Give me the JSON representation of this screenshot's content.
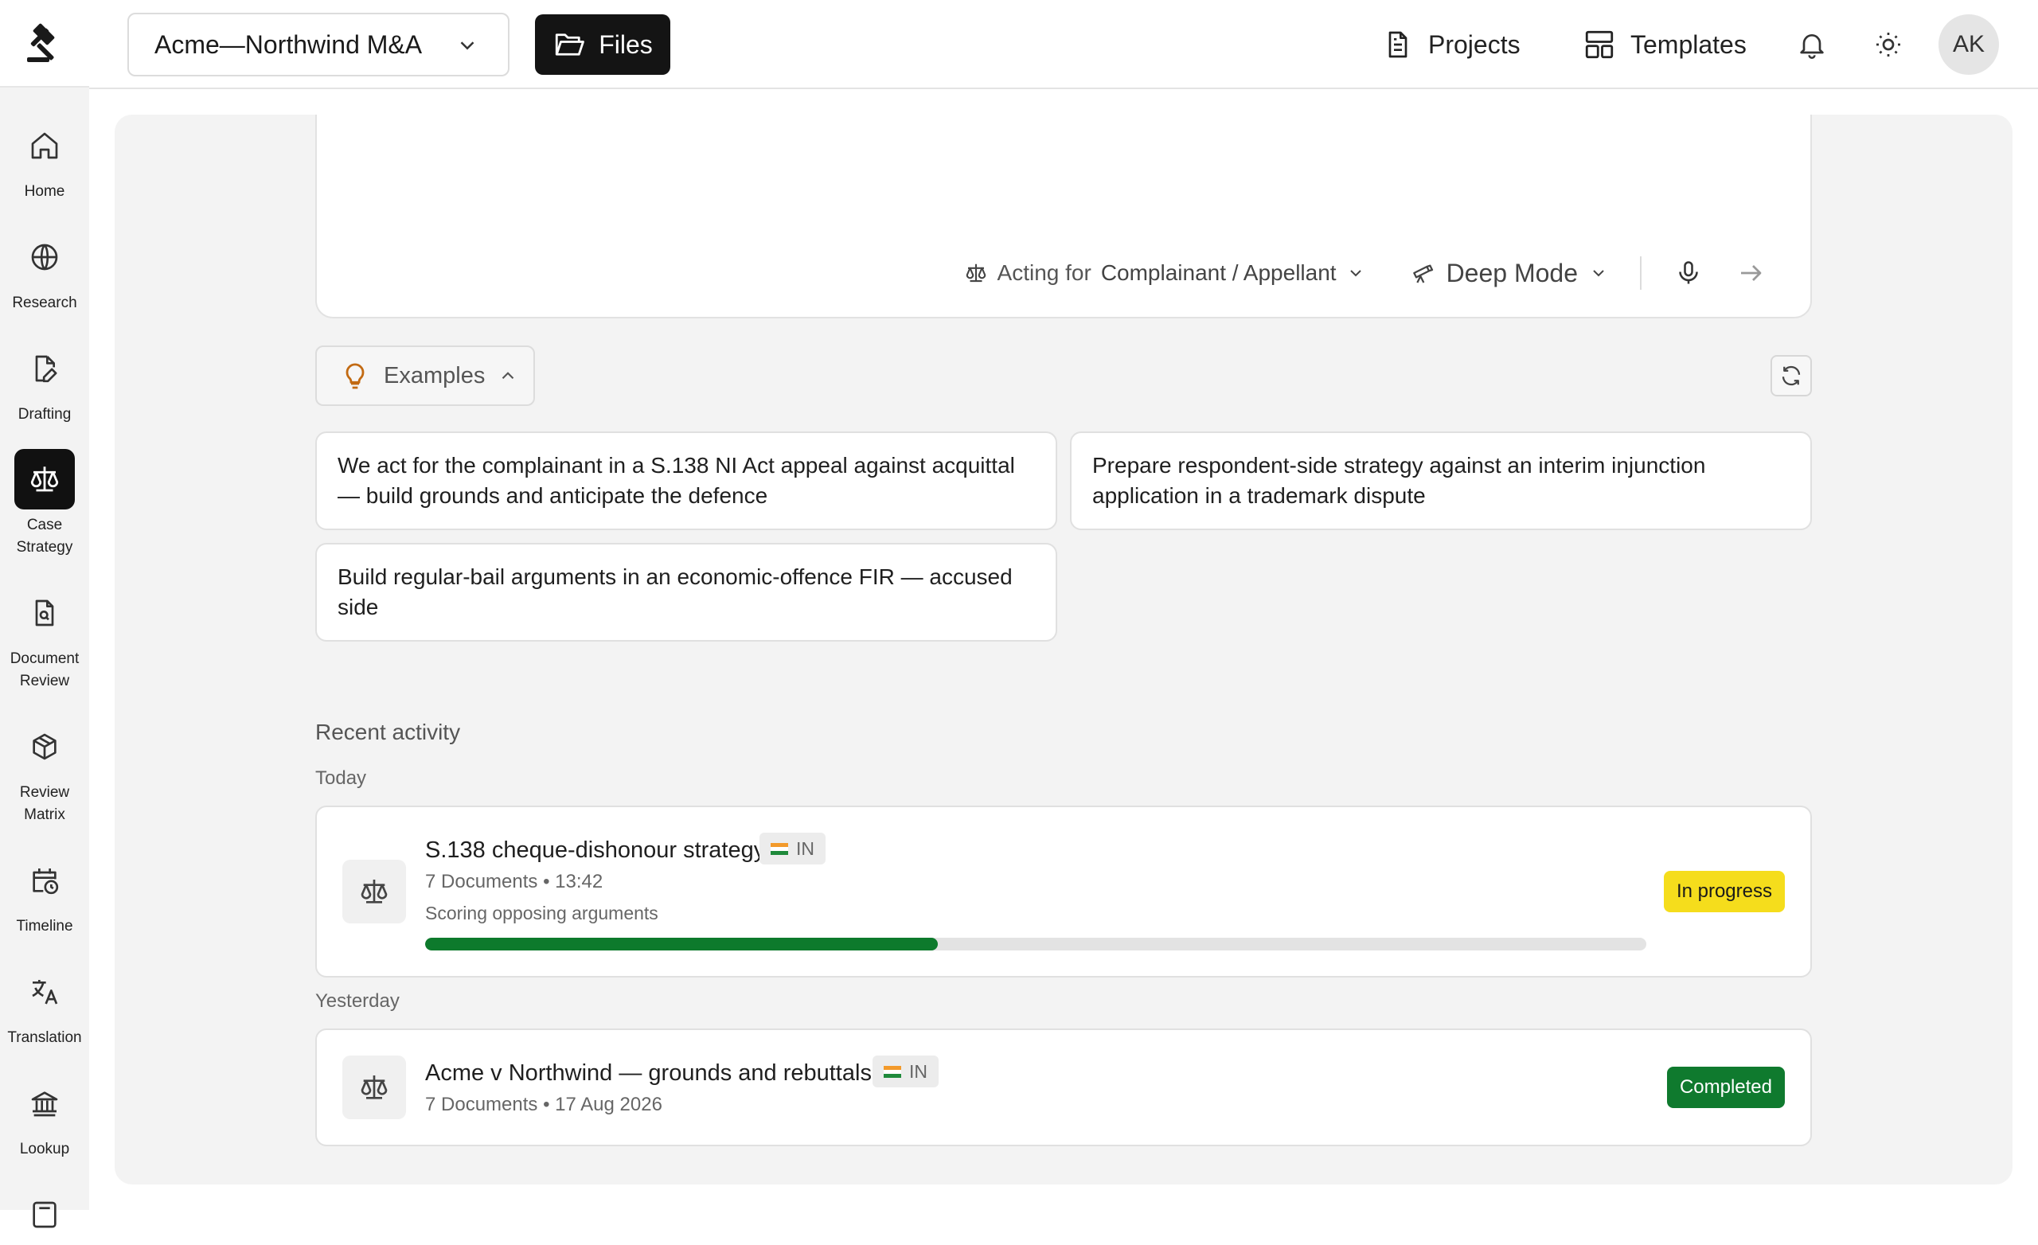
{
  "colors": {
    "accent": "#141414",
    "progress": "#0d7a2c",
    "in_progress_badge": "#f5dd1c",
    "completed_badge": "#0f7a2e"
  },
  "sidebar": {
    "logo": "gavel-icon",
    "items": [
      {
        "label": "Home",
        "icon": "home-icon",
        "active": false
      },
      {
        "label": "Research",
        "icon": "globe-icon",
        "active": false
      },
      {
        "label": "Drafting",
        "icon": "file-pen-icon",
        "active": false
      },
      {
        "label": "Case Strategy",
        "icon": "scale-icon",
        "active": true
      },
      {
        "label": "Document Review",
        "icon": "file-search-icon",
        "active": false
      },
      {
        "label": "Review Matrix",
        "icon": "box-icon",
        "active": false
      },
      {
        "label": "Timeline",
        "icon": "calendar-clock-icon",
        "active": false
      },
      {
        "label": "Translation",
        "icon": "languages-icon",
        "active": false
      },
      {
        "label": "Lookup",
        "icon": "landmark-icon",
        "active": false
      }
    ]
  },
  "header": {
    "matter": "Acme—Northwind M&A",
    "files_label": "Files",
    "projects_label": "Projects",
    "templates_label": "Templates",
    "avatar_initials": "AK"
  },
  "composer": {
    "acting_prefix": "Acting for",
    "acting_value": "Complainant / Appellant",
    "mode_label": "Deep Mode"
  },
  "examples": {
    "toggle_label": "Examples",
    "items": [
      "We act for the complainant in a S.138 NI Act appeal against acquittal — build grounds and anticipate the defence",
      "Prepare respondent-side strategy against an interim injunction application in a trademark dispute",
      "Build regular-bail arguments in an economic-offence FIR — accused side"
    ]
  },
  "recent": {
    "title": "Recent activity",
    "groups": [
      {
        "label": "Today",
        "items": [
          {
            "title": "S.138 cheque-dishonour strategy",
            "region": "IN",
            "meta": "7 Documents • 13:42",
            "status_text": "Scoring opposing arguments",
            "progress": 0.42,
            "badge": "In progress"
          }
        ]
      },
      {
        "label": "Yesterday",
        "items": [
          {
            "title": "Acme v Northwind — grounds and rebuttals",
            "region": "IN",
            "meta": "7 Documents • 17 Aug 2026",
            "badge": "Completed"
          }
        ]
      }
    ]
  }
}
